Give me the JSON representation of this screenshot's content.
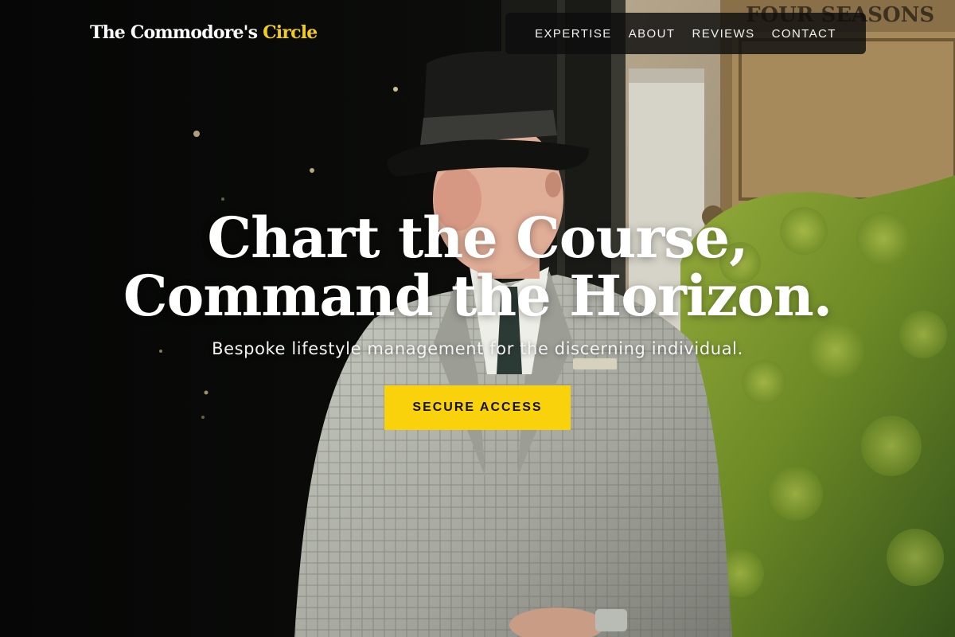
{
  "header": {
    "brand_main": "The Commodore's",
    "brand_accent": "Circle"
  },
  "nav": {
    "items": [
      {
        "label": "EXPERTISE"
      },
      {
        "label": "ABOUT"
      },
      {
        "label": "REVIEWS"
      },
      {
        "label": "CONTACT"
      }
    ]
  },
  "hero": {
    "headline_line1": "Chart the Course,",
    "headline_line2": "Command the Horizon.",
    "tagline": "Bespoke lifestyle management for the discerning individual.",
    "cta_label": "SECURE ACCESS",
    "background_sign_text": "FOUR SEASONS"
  },
  "colors": {
    "accent": "#f2cc1e",
    "cta_background": "#f9d20c",
    "nav_background": "#0e0e0e",
    "text": "#ffffff"
  }
}
